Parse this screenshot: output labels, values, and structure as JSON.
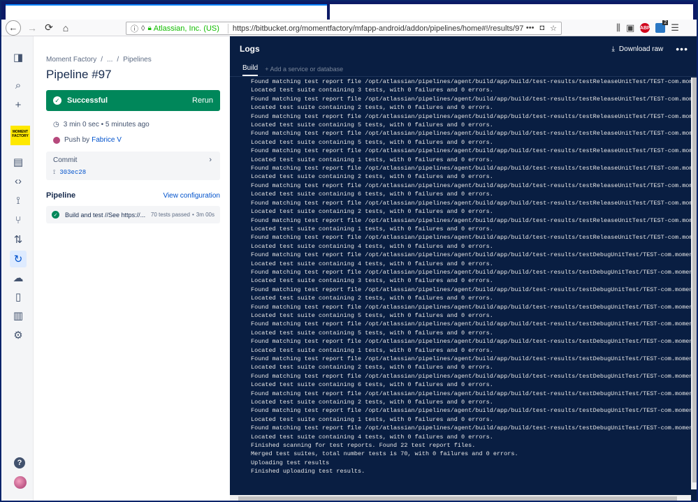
{
  "browser": {
    "org": "Atlassian, Inc. (US)",
    "url": "https://bitbucket.org/momentfactory/mfapp-android/addon/pipelines/home#!/results/97",
    "url_dots": "•••",
    "ext_badge": "2",
    "abp": "ABP"
  },
  "sidebar": {
    "logo_text": "MOMENT FACTORY"
  },
  "panel": {
    "breadcrumb": [
      "Moment Factory",
      "/",
      "...",
      "/",
      "Pipelines"
    ],
    "title": "Pipeline #97",
    "status": "Successful",
    "rerun": "Rerun",
    "duration": "3 min 0 sec • 5 minutes ago",
    "push_prefix": "Push by",
    "author": "Fabrice V",
    "commit_label": "Commit",
    "commit_hash": "303ec28",
    "pipeline_heading": "Pipeline",
    "view_config": "View configuration",
    "step_name": "Build and test //See https://...",
    "step_tests": "70 tests passed",
    "step_duration": "3m 00s"
  },
  "logs": {
    "title": "Logs",
    "download": "Download raw",
    "tab_build": "Build",
    "add_service": "+ Add a service or database",
    "lines": [
      "Found matching test report file /opt/atlassian/pipelines/agent/build/app/build/test-results/testReleaseUnitTest/TEST-com.momentfacto",
      "Located test suite containing 3 tests, with 0 failures and 0 errors.",
      "Found matching test report file /opt/atlassian/pipelines/agent/build/app/build/test-results/testReleaseUnitTest/TEST-com.momentfacto",
      "Located test suite containing 2 tests, with 0 failures and 0 errors.",
      "Found matching test report file /opt/atlassian/pipelines/agent/build/app/build/test-results/testReleaseUnitTest/TEST-com.momentfacto",
      "Located test suite containing 5 tests, with 0 failures and 0 errors.",
      "Found matching test report file /opt/atlassian/pipelines/agent/build/app/build/test-results/testReleaseUnitTest/TEST-com.momentfacto",
      "Located test suite containing 5 tests, with 0 failures and 0 errors.",
      "Found matching test report file /opt/atlassian/pipelines/agent/build/app/build/test-results/testReleaseUnitTest/TEST-com.momentfacto",
      "Located test suite containing 1 tests, with 0 failures and 0 errors.",
      "Found matching test report file /opt/atlassian/pipelines/agent/build/app/build/test-results/testReleaseUnitTest/TEST-com.momentfacto",
      "Located test suite containing 2 tests, with 0 failures and 0 errors.",
      "Found matching test report file /opt/atlassian/pipelines/agent/build/app/build/test-results/testReleaseUnitTest/TEST-com.momentfacto",
      "Located test suite containing 6 tests, with 0 failures and 0 errors.",
      "Found matching test report file /opt/atlassian/pipelines/agent/build/app/build/test-results/testReleaseUnitTest/TEST-com.momentfacto",
      "Located test suite containing 2 tests, with 0 failures and 0 errors.",
      "Found matching test report file /opt/atlassian/pipelines/agent/build/app/build/test-results/testReleaseUnitTest/TEST-com.momentfacto",
      "Located test suite containing 1 tests, with 0 failures and 0 errors.",
      "Found matching test report file /opt/atlassian/pipelines/agent/build/app/build/test-results/testReleaseUnitTest/TEST-com.momentfacto",
      "Located test suite containing 4 tests, with 0 failures and 0 errors.",
      "Found matching test report file /opt/atlassian/pipelines/agent/build/app/build/test-results/testDebugUnitTest/TEST-com.momentfactory",
      "Located test suite containing 4 tests, with 0 failures and 0 errors.",
      "Found matching test report file /opt/atlassian/pipelines/agent/build/app/build/test-results/testDebugUnitTest/TEST-com.momentfactory",
      "Located test suite containing 3 tests, with 0 failures and 0 errors.",
      "Found matching test report file /opt/atlassian/pipelines/agent/build/app/build/test-results/testDebugUnitTest/TEST-com.momentfactory",
      "Located test suite containing 2 tests, with 0 failures and 0 errors.",
      "Found matching test report file /opt/atlassian/pipelines/agent/build/app/build/test-results/testDebugUnitTest/TEST-com.momentfactory",
      "Located test suite containing 5 tests, with 0 failures and 0 errors.",
      "Found matching test report file /opt/atlassian/pipelines/agent/build/app/build/test-results/testDebugUnitTest/TEST-com.momentfactory",
      "Located test suite containing 5 tests, with 0 failures and 0 errors.",
      "Found matching test report file /opt/atlassian/pipelines/agent/build/app/build/test-results/testDebugUnitTest/TEST-com.momentfactory",
      "Located test suite containing 1 tests, with 0 failures and 0 errors.",
      "Found matching test report file /opt/atlassian/pipelines/agent/build/app/build/test-results/testDebugUnitTest/TEST-com.momentfactory",
      "Located test suite containing 2 tests, with 0 failures and 0 errors.",
      "Found matching test report file /opt/atlassian/pipelines/agent/build/app/build/test-results/testDebugUnitTest/TEST-com.momentfactory",
      "Located test suite containing 6 tests, with 0 failures and 0 errors.",
      "Found matching test report file /opt/atlassian/pipelines/agent/build/app/build/test-results/testDebugUnitTest/TEST-com.momentfactory",
      "Located test suite containing 2 tests, with 0 failures and 0 errors.",
      "Found matching test report file /opt/atlassian/pipelines/agent/build/app/build/test-results/testDebugUnitTest/TEST-com.momentfactory",
      "Located test suite containing 1 tests, with 0 failures and 0 errors.",
      "Found matching test report file /opt/atlassian/pipelines/agent/build/app/build/test-results/testDebugUnitTest/TEST-com.momentfactory",
      "Located test suite containing 4 tests, with 0 failures and 0 errors.",
      "Finished scanning for test reports. Found 22 test report files.",
      "Merged test suites, total number tests is 70, with 0 failures and 0 errors.",
      "Uploading test results",
      "Finished uploading test results."
    ]
  }
}
